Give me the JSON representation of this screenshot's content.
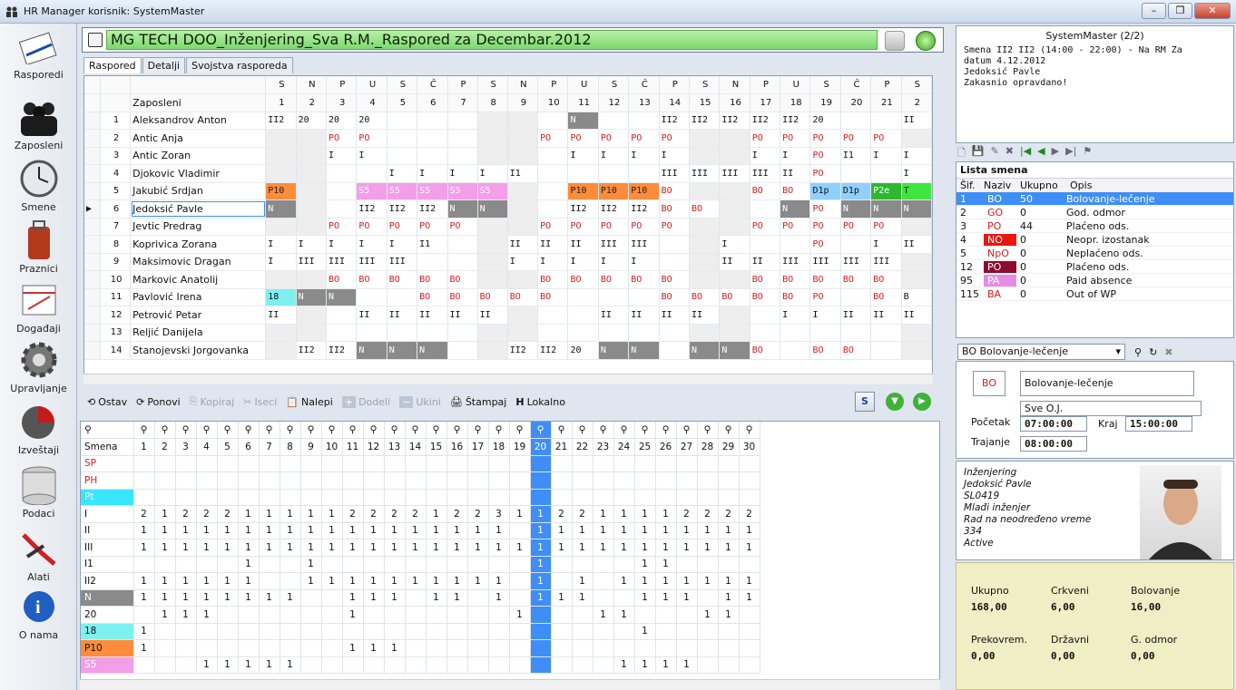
{
  "window": {
    "title": "HR Manager korisnik: SystemMaster"
  },
  "nav": [
    {
      "label": "Rasporedi",
      "icon": "clipboard-icon"
    },
    {
      "label": "Zaposleni",
      "icon": "people-icon"
    },
    {
      "label": "Smene",
      "icon": "clock-icon"
    },
    {
      "label": "Praznici",
      "icon": "suitcase-icon"
    },
    {
      "label": "Događaji",
      "icon": "calendar-icon"
    },
    {
      "label": "Upravljanje",
      "icon": "gear-icon"
    },
    {
      "label": "Izveštaji",
      "icon": "pie-chart-icon"
    },
    {
      "label": "Podaci",
      "icon": "database-icon"
    },
    {
      "label": "Alati",
      "icon": "pliers-icon"
    },
    {
      "label": "O nama",
      "icon": "info-icon"
    }
  ],
  "header": {
    "title": "MG TECH DOO_Inženjering_Sva R.M._Raspored za Decembar.2012"
  },
  "tabs": [
    "Raspored",
    "Detalji",
    "Svojstva rasporeda"
  ],
  "schedule": {
    "day_letters": [
      "S",
      "N",
      "P",
      "U",
      "S",
      "Č",
      "P",
      "S",
      "N",
      "P",
      "U",
      "S",
      "Č",
      "P",
      "S",
      "N",
      "P",
      "U",
      "S",
      "Č",
      "P",
      "S"
    ],
    "day_numbers": [
      "1",
      "2",
      "3",
      "4",
      "5",
      "6",
      "7",
      "8",
      "9",
      "10",
      "11",
      "12",
      "13",
      "14",
      "15",
      "16",
      "17",
      "18",
      "19",
      "20",
      "21",
      "2"
    ],
    "col_header": "Zaposleni",
    "rows": [
      {
        "no": "1",
        "name": "Aleksandrov Anton",
        "cells": [
          "II2",
          "20",
          "20",
          "20",
          "",
          "",
          "",
          "",
          "",
          "",
          "N",
          "",
          "",
          "II2",
          "II2",
          "II2",
          "II2",
          "II2",
          "20",
          "",
          "",
          "II"
        ]
      },
      {
        "no": "2",
        "name": "Antic Anja",
        "cells": [
          "",
          "",
          "PO",
          "PO",
          "",
          "",
          "",
          "",
          "",
          "PO",
          "PO",
          "PO",
          "PO",
          "PO",
          "",
          "",
          "PO",
          "PO",
          "PO",
          "PO",
          "PO",
          ""
        ]
      },
      {
        "no": "3",
        "name": "Antic Zoran",
        "cells": [
          "",
          "",
          "I",
          "I",
          "",
          "",
          "",
          "",
          "",
          "",
          "I",
          "I",
          "I",
          "I",
          "",
          "",
          "I",
          "I",
          "PO",
          "I1",
          "I",
          "I"
        ]
      },
      {
        "no": "4",
        "name": "Djokovic Vladimir",
        "cells": [
          "",
          "",
          "",
          "",
          "I",
          "I",
          "I",
          "I",
          "I1",
          "",
          "",
          "",
          "",
          "III",
          "III",
          "III",
          "III",
          "II",
          "PO",
          "",
          "",
          "I"
        ]
      },
      {
        "no": "5",
        "name": "Jakubić Srdjan",
        "cells": [
          "P10",
          "",
          "",
          "S5",
          "S5",
          "S5",
          "S5",
          "S5",
          "",
          "",
          "P10",
          "P10",
          "P10",
          "BO",
          "",
          "",
          "BO",
          "BO",
          "D1p",
          "D1p",
          "P2e",
          "T"
        ]
      },
      {
        "no": "6",
        "name": "Jedoksić Pavle",
        "cells": [
          "N",
          "",
          "",
          "II2",
          "II2",
          "II2",
          "N",
          "N",
          "",
          "",
          "II2",
          "II2",
          "II2",
          "BO",
          "BO",
          "",
          "",
          "N",
          "PO",
          "N",
          "N",
          "N"
        ]
      },
      {
        "no": "7",
        "name": "Jevtic Predrag",
        "cells": [
          "",
          "",
          "PO",
          "PO",
          "PO",
          "PO",
          "PO",
          "",
          "",
          "PO",
          "PO",
          "PO",
          "PO",
          "PO",
          "",
          "",
          "PO",
          "PO",
          "PO",
          "PO",
          "PO",
          ""
        ]
      },
      {
        "no": "8",
        "name": "Koprivica Zorana",
        "cells": [
          "I",
          "I",
          "I",
          "I",
          "I",
          "I1",
          "",
          "",
          "II",
          "II",
          "II",
          "III",
          "III",
          "",
          "",
          "I",
          "",
          "",
          "PO",
          "",
          "I",
          "II"
        ]
      },
      {
        "no": "9",
        "name": "Maksimovic Dragan",
        "cells": [
          "I",
          "III",
          "III",
          "III",
          "III",
          "",
          "",
          "",
          "I",
          "I",
          "I",
          "I",
          "I",
          "",
          "",
          "II",
          "II",
          "III",
          "III",
          "III",
          "III",
          ""
        ]
      },
      {
        "no": "10",
        "name": "Markovic Anatolij",
        "cells": [
          "",
          "",
          "BO",
          "BO",
          "BO",
          "BO",
          "BO",
          "",
          "",
          "BO",
          "BO",
          "BO",
          "BO",
          "BO",
          "",
          "",
          "BO",
          "BO",
          "BO",
          "BO",
          "BO",
          ""
        ]
      },
      {
        "no": "11",
        "name": "Pavlović Irena",
        "cells": [
          "18",
          "N",
          "N",
          "",
          "",
          "BO",
          "BO",
          "BO",
          "BO",
          "BO",
          "",
          "",
          "",
          "BO",
          "BO",
          "BO",
          "BO",
          "BO",
          "PO",
          "",
          "BO",
          "B"
        ]
      },
      {
        "no": "12",
        "name": "Petrović Petar",
        "cells": [
          "II",
          "",
          "",
          "II",
          "II",
          "II",
          "II",
          "II",
          "",
          "",
          "",
          "II",
          "II",
          "II",
          "II",
          "",
          "",
          "I",
          "I",
          "II",
          "II",
          "II"
        ]
      },
      {
        "no": "13",
        "name": "Reljić Danijela",
        "cells": [
          "",
          "",
          "",
          "",
          "",
          "",
          "",
          "",
          "",
          "",
          "",
          "",
          "",
          "",
          "",
          "",
          "",
          "",
          "",
          "",
          "",
          ""
        ]
      },
      {
        "no": "14",
        "name": "Stanojevski Jorgovanka",
        "cells": [
          "",
          "II2",
          "II2",
          "N",
          "N",
          "N",
          "",
          "",
          "II2",
          "II2",
          "20",
          "N",
          "N",
          "",
          "N",
          "N",
          "BO",
          "",
          "BO",
          "BO",
          "",
          ""
        ]
      }
    ]
  },
  "toolbar": {
    "ostavi": "Ostav",
    "ponovi": "Ponovi",
    "kopiraj": "Kopiraj",
    "iseci": "Iseci",
    "nalepi": "Nalepi",
    "dodeli": "Dodeli",
    "ukini": "Ukini",
    "stampaj": "Štampaj",
    "lokalno": "Lokalno"
  },
  "summary": {
    "col_header": "Smena",
    "days": [
      "1",
      "2",
      "3",
      "4",
      "5",
      "6",
      "7",
      "8",
      "9",
      "10",
      "11",
      "12",
      "13",
      "14",
      "15",
      "16",
      "17",
      "18",
      "19",
      "20",
      "21",
      "22",
      "23",
      "24",
      "25",
      "26",
      "27",
      "28",
      "29",
      "30"
    ],
    "selected_day": "20",
    "rows": [
      {
        "shift": "SP",
        "cells": [
          "",
          "",
          "",
          "",
          "",
          "",
          "",
          "",
          "",
          "",
          "",
          "",
          "",
          "",
          "",
          "",
          "",
          "",
          "",
          "",
          "",
          "",
          "",
          "",
          "",
          "",
          "",
          "",
          "",
          ""
        ]
      },
      {
        "shift": "PH",
        "cells": [
          "",
          "",
          "",
          "",
          "",
          "",
          "",
          "",
          "",
          "",
          "",
          "",
          "",
          "",
          "",
          "",
          "",
          "",
          "",
          "",
          "",
          "",
          "",
          "",
          "",
          "",
          "",
          "",
          "",
          ""
        ]
      },
      {
        "shift": "Pt",
        "cells": [
          "",
          "",
          "",
          "",
          "",
          "",
          "",
          "",
          "",
          "",
          "",
          "",
          "",
          "",
          "",
          "",
          "",
          "",
          "",
          "",
          "",
          "",
          "",
          "",
          "",
          "",
          "",
          "",
          "",
          ""
        ]
      },
      {
        "shift": "I",
        "cells": [
          "2",
          "1",
          "2",
          "2",
          "2",
          "1",
          "1",
          "1",
          "1",
          "1",
          "2",
          "2",
          "2",
          "2",
          "1",
          "2",
          "2",
          "3",
          "1",
          "1",
          "2",
          "2",
          "1",
          "1",
          "1",
          "1",
          "2",
          "2",
          "2",
          "2"
        ]
      },
      {
        "shift": "II",
        "cells": [
          "1",
          "1",
          "1",
          "1",
          "1",
          "1",
          "1",
          "1",
          "1",
          "1",
          "1",
          "1",
          "1",
          "1",
          "1",
          "1",
          "1",
          "1",
          "",
          "1",
          "1",
          "1",
          "1",
          "1",
          "1",
          "1",
          "1",
          "1",
          "1",
          "1"
        ]
      },
      {
        "shift": "III",
        "cells": [
          "1",
          "1",
          "1",
          "1",
          "1",
          "1",
          "1",
          "1",
          "1",
          "1",
          "1",
          "1",
          "1",
          "1",
          "1",
          "1",
          "1",
          "1",
          "1",
          "1",
          "1",
          "1",
          "1",
          "1",
          "1",
          "1",
          "1",
          "1",
          "1",
          "1"
        ]
      },
      {
        "shift": "I1",
        "cells": [
          "",
          "",
          "",
          "",
          "",
          "1",
          "",
          "",
          "1",
          "",
          "",
          "",
          "",
          "",
          "",
          "",
          "",
          "",
          "",
          "1",
          "",
          "",
          "",
          "",
          "1",
          "1",
          "",
          "",
          "",
          ""
        ]
      },
      {
        "shift": "II2",
        "cells": [
          "1",
          "1",
          "1",
          "1",
          "1",
          "1",
          "",
          "",
          "1",
          "1",
          "1",
          "1",
          "1",
          "1",
          "1",
          "1",
          "1",
          "1",
          "",
          "1",
          "",
          "1",
          "",
          "1",
          "1",
          "1",
          "1",
          "1",
          "1",
          "1"
        ]
      },
      {
        "shift": "N",
        "cells": [
          "1",
          "1",
          "1",
          "1",
          "1",
          "1",
          "1",
          "1",
          "",
          "",
          "1",
          "1",
          "1",
          "",
          "1",
          "1",
          "",
          "1",
          "",
          "1",
          "1",
          "1",
          "",
          "",
          "1",
          "1",
          "1",
          "",
          "1",
          "1"
        ]
      },
      {
        "shift": "20",
        "cells": [
          "",
          "1",
          "1",
          "1",
          "",
          "",
          "",
          "",
          "",
          "",
          "1",
          "",
          "",
          "",
          "",
          "",
          "",
          "",
          "1",
          "",
          "",
          "",
          "1",
          "1",
          "",
          "",
          "",
          "1",
          "1",
          ""
        ]
      },
      {
        "shift": "18",
        "cells": [
          "1",
          "",
          "",
          "",
          "",
          "",
          "",
          "",
          "",
          "",
          "",
          "",
          "",
          "",
          "",
          "",
          "",
          "",
          "",
          "",
          "",
          "",
          "",
          "",
          "1",
          "",
          "",
          "",
          "",
          ""
        ]
      },
      {
        "shift": "P10",
        "cells": [
          "1",
          "",
          "",
          "",
          "",
          "",
          "",
          "",
          "",
          "",
          "1",
          "1",
          "1",
          "",
          "",
          "",
          "",
          "",
          "",
          "",
          "",
          "",
          "",
          "",
          "",
          "",
          "",
          "",
          "",
          ""
        ]
      },
      {
        "shift": "S5",
        "cells": [
          "",
          "",
          "",
          "1",
          "1",
          "1",
          "1",
          "1",
          "",
          "",
          "",
          "",
          "",
          "",
          "",
          "",
          "",
          "",
          "",
          "",
          "",
          "",
          "",
          "1",
          "1",
          "1",
          "1",
          "",
          "",
          ""
        ]
      }
    ]
  },
  "right": {
    "user": "SystemMaster (2/2)",
    "note": [
      "Smena II2 II2 (14:00 - 22:00) - Na RM Za",
      "datum 4.12.2012",
      "Jedoksić Pavle",
      "Zakasnio opravdano!"
    ],
    "list_title": "Lista smena",
    "list_headers": [
      "Šif.",
      "Naziv",
      "Ukupno",
      "Opis"
    ],
    "list": [
      {
        "id": "1",
        "code": "BO",
        "total": "50",
        "desc": "Bolovanje-lečenje",
        "color": "#3f8ef5"
      },
      {
        "id": "2",
        "code": "GO",
        "total": "0",
        "desc": "God. odmor",
        "color": "#ffffff"
      },
      {
        "id": "3",
        "code": "PO",
        "total": "44",
        "desc": "Plaćeno ods.",
        "color": "#ffffff"
      },
      {
        "id": "4",
        "code": "NO",
        "total": "0",
        "desc": "Neopr. izostanak",
        "color": "#e8170f"
      },
      {
        "id": "5",
        "code": "NpO",
        "total": "0",
        "desc": "Neplaćeno ods.",
        "color": "#ffffff"
      },
      {
        "id": "12",
        "code": "PO",
        "total": "0",
        "desc": "Plaćeno ods.",
        "color": "#8b0d2e"
      },
      {
        "id": "95",
        "code": "PA",
        "total": "0",
        "desc": "Paid absence",
        "color": "#e58de5"
      },
      {
        "id": "115",
        "code": "BA",
        "total": "0",
        "desc": "Out of WP",
        "color": "#ffffff"
      }
    ],
    "combo": "BO Bolovanje-lečenje",
    "shift_code": "BO",
    "shift_name": "Bolovanje-lečenje",
    "org": "Sve O.J.",
    "start_label": "Početak",
    "start": "07:00:00",
    "end_label": "Kraj",
    "end": "15:00:00",
    "duration_label": "Trajanje",
    "duration": "08:00:00",
    "employee": [
      "Inženjering",
      "Jedoksić Pavle",
      "SL0419",
      "Mlađi inženjer",
      "Rad na neodređeno vreme",
      "334",
      "Active"
    ],
    "stats": [
      {
        "label": "Ukupno",
        "value": "168,00"
      },
      {
        "label": "Crkveni",
        "value": "6,00"
      },
      {
        "label": "Bolovanje",
        "value": "16,00"
      },
      {
        "label": "Prekovrem.",
        "value": "0,00"
      },
      {
        "label": "Državni",
        "value": "0,00"
      },
      {
        "label": "G. odmor",
        "value": "0,00"
      }
    ]
  }
}
